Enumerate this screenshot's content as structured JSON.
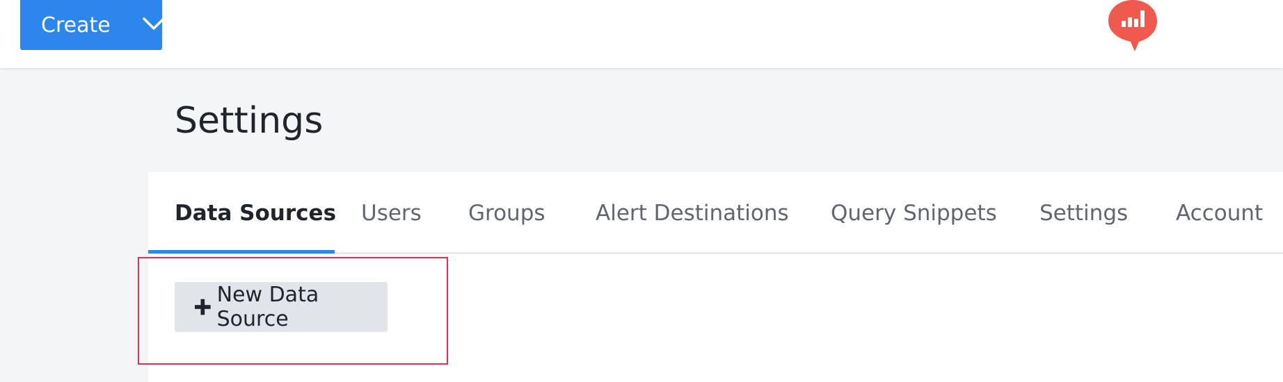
{
  "header": {
    "create_label": "Create",
    "create_icon": "chevron-down-icon",
    "logo_icon": "redash-logo-icon",
    "brand_color": "#2d86ec",
    "logo_color": "#ef5a4c"
  },
  "page": {
    "title": "Settings"
  },
  "tabs": [
    {
      "label": "Data Sources",
      "active": true
    },
    {
      "label": "Users",
      "active": false
    },
    {
      "label": "Groups",
      "active": false
    },
    {
      "label": "Alert Destinations",
      "active": false
    },
    {
      "label": "Query Snippets",
      "active": false
    },
    {
      "label": "Settings",
      "active": false
    },
    {
      "label": "Account",
      "active": false
    }
  ],
  "actions": {
    "new_data_source_label": "New Data Source",
    "new_data_source_icon": "plus-icon"
  },
  "annotation": {
    "highlight_color": "#e0304a"
  }
}
